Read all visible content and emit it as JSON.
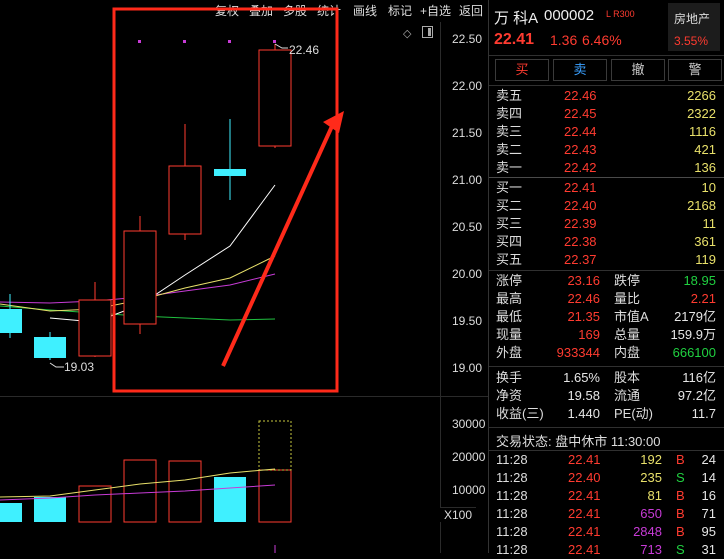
{
  "toolbar": {
    "buttons": [
      "复权",
      "叠加",
      "多股",
      "统计",
      "画线",
      "标记",
      "+自选",
      "返回"
    ]
  },
  "chart": {
    "price_axis": [
      "22.50",
      "22.00",
      "21.50",
      "21.00",
      "20.50",
      "20.00",
      "19.50",
      "19.00"
    ],
    "volume_axis": [
      "30000",
      "20000",
      "10000"
    ],
    "volume_unit": "X100",
    "high_marker": "22.46",
    "low_marker": "19.03",
    "colors": {
      "up": "#ff3b30",
      "down": "#3ff0ff",
      "annotation": "#ff2a1a",
      "ma5": "#ffffff",
      "ma10": "#e8e06a",
      "ma20": "#c73bd6",
      "ma60": "#20c040"
    }
  },
  "quote": {
    "name": "万 科A",
    "code": "000002",
    "tags": "L R300",
    "price": "22.41",
    "change": "1.36",
    "change_pct": "6.46%",
    "sector": "房地产",
    "sector_pct": "3.55%"
  },
  "actions": [
    "买",
    "卖",
    "撤",
    "警"
  ],
  "asks": [
    {
      "label": "卖五",
      "price": "22.46",
      "vol": "2266"
    },
    {
      "label": "卖四",
      "price": "22.45",
      "vol": "2322"
    },
    {
      "label": "卖三",
      "price": "22.44",
      "vol": "1116"
    },
    {
      "label": "卖二",
      "price": "22.43",
      "vol": "421"
    },
    {
      "label": "卖一",
      "price": "22.42",
      "vol": "136"
    }
  ],
  "bids": [
    {
      "label": "买一",
      "price": "22.41",
      "vol": "10"
    },
    {
      "label": "买二",
      "price": "22.40",
      "vol": "2168"
    },
    {
      "label": "买三",
      "price": "22.39",
      "vol": "11"
    },
    {
      "label": "买四",
      "price": "22.38",
      "vol": "361"
    },
    {
      "label": "买五",
      "price": "22.37",
      "vol": "119"
    }
  ],
  "stats1": [
    {
      "l1": "涨停",
      "v1": "23.16",
      "l2": "跌停",
      "v2": "18.95"
    },
    {
      "l1": "最高",
      "v1": "22.46",
      "l2": "量比",
      "v2": "2.21"
    },
    {
      "l1": "最低",
      "v1": "21.35",
      "l2": "市值A",
      "v2": "2179亿"
    },
    {
      "l1": "现量",
      "v1": "169",
      "l2": "总量",
      "v2": "159.9万"
    },
    {
      "l1": "外盘",
      "v1": "933344",
      "l2": "内盘",
      "v2": "666100"
    }
  ],
  "stats2": [
    {
      "l1": "换手",
      "v1": "1.65%",
      "l2": "股本",
      "v2": "116亿"
    },
    {
      "l1": "净资",
      "v1": "19.58",
      "l2": "流通",
      "v2": "97.2亿"
    },
    {
      "l1": "收益(三)",
      "v1": "1.440",
      "l2": "PE(动)",
      "v2": "11.7"
    }
  ],
  "trade_status": "交易状态: 盘中休市 11:30:00",
  "trades": [
    {
      "time": "11:28",
      "price": "22.41",
      "vol": "192",
      "side": "B",
      "n": "24"
    },
    {
      "time": "11:28",
      "price": "22.40",
      "vol": "235",
      "side": "S",
      "n": "14"
    },
    {
      "time": "11:28",
      "price": "22.41",
      "vol": "81",
      "side": "B",
      "n": "16"
    },
    {
      "time": "11:28",
      "price": "22.41",
      "vol": "650",
      "side": "B",
      "n": "71"
    },
    {
      "time": "11:28",
      "price": "22.41",
      "vol": "2848",
      "side": "B",
      "n": "95"
    },
    {
      "time": "11:28",
      "price": "22.41",
      "vol": "713",
      "side": "S",
      "n": "31"
    }
  ]
}
